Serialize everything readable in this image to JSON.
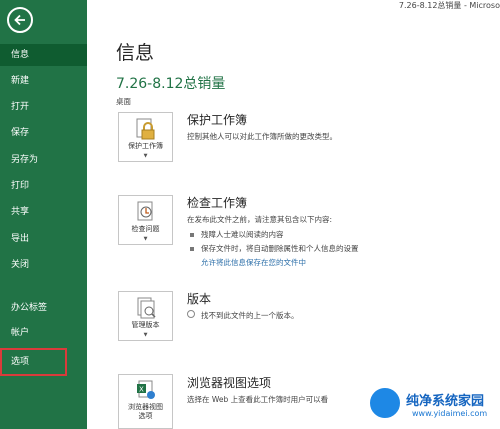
{
  "window": {
    "title": "7.26-8.12总销量 - Microso"
  },
  "sidebar": {
    "items": [
      {
        "label": "信息"
      },
      {
        "label": "新建"
      },
      {
        "label": "打开"
      },
      {
        "label": "保存"
      },
      {
        "label": "另存为"
      },
      {
        "label": "打印"
      },
      {
        "label": "共享"
      },
      {
        "label": "导出"
      },
      {
        "label": "关闭"
      },
      {
        "label": "办公标签"
      },
      {
        "label": "帐户"
      },
      {
        "label": "选项"
      }
    ]
  },
  "info": {
    "page_title": "信息",
    "file_name": "7.26-8.12总销量",
    "location": "桌面",
    "protect": {
      "button": "保护工作簿",
      "title": "保护工作簿",
      "desc": "控制其他人可以对此工作簿所做的更改类型。"
    },
    "inspect": {
      "button": "检查问题",
      "title": "检查工作簿",
      "desc": "在发布此文件之前，请注意其包含以下内容:",
      "bullets": [
        "残障人士难以阅读的内容",
        "保存文件时，将自动删除属性和个人信息的设置"
      ],
      "link": "允许将此信息保存在您的文件中"
    },
    "versions": {
      "button": "管理版本",
      "title": "版本",
      "desc": "找不到此文件的上一个版本。"
    },
    "browser": {
      "button_line1": "浏览器视图",
      "button_line2": "选项",
      "title": "浏览器视图选项",
      "desc": "选择在 Web 上查看此工作簿时用户可以看"
    }
  },
  "watermark": {
    "name": "纯净系统家园",
    "url": "www.yidaimei.com"
  },
  "colors": {
    "sidebar": "#217346",
    "accent": "#217346",
    "highlight_border": "#d93b3b",
    "link": "#2b6ea8"
  }
}
